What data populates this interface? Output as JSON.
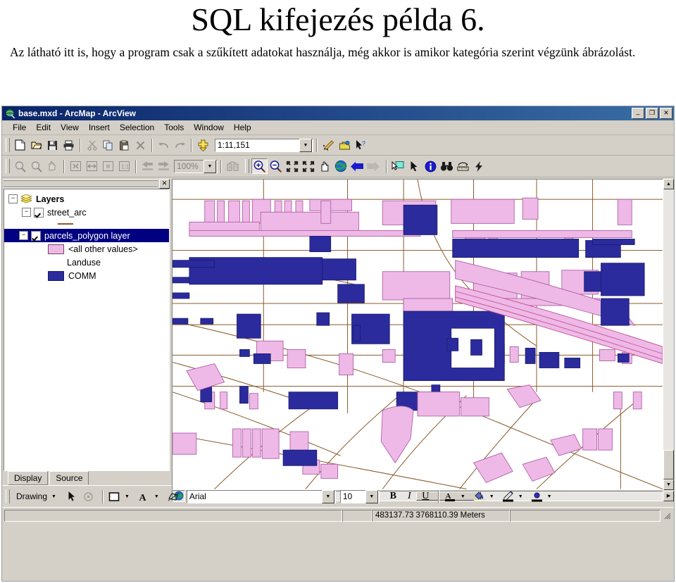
{
  "slide": {
    "title": "SQL kifejezés példa 6.",
    "body": "Az látható itt is, hogy a program csak a szűkített adatokat használja, még akkor is amikor kategória szerint végzünk ábrázolást."
  },
  "window": {
    "title": "base.mxd - ArcMap - ArcView",
    "app_icon": "arcmap-globe-icon",
    "controls": [
      {
        "name": "minimize-button",
        "glyph": "_"
      },
      {
        "name": "maximize-button",
        "glyph": "❐"
      },
      {
        "name": "close-button",
        "glyph": "✕"
      }
    ]
  },
  "menubar": {
    "items": [
      "File",
      "Edit",
      "View",
      "Insert",
      "Selection",
      "Tools",
      "Window",
      "Help"
    ]
  },
  "standard_toolbar": {
    "buttons": [
      {
        "name": "new-document-button",
        "icon": "new-page-icon",
        "glyph": "🗋",
        "disabled": false
      },
      {
        "name": "open-document-button",
        "icon": "open-folder-icon",
        "glyph": "📂",
        "disabled": false
      },
      {
        "name": "save-document-button",
        "icon": "floppy-disk-icon",
        "glyph": "💾",
        "disabled": false
      },
      {
        "name": "print-button",
        "icon": "printer-icon",
        "glyph": "🖶",
        "disabled": false
      },
      {
        "name": "cut-button",
        "icon": "scissors-icon",
        "glyph": "✂",
        "disabled": true
      },
      {
        "name": "copy-button",
        "icon": "copy-icon",
        "glyph": "⧉",
        "disabled": false
      },
      {
        "name": "paste-button",
        "icon": "clipboard-icon",
        "glyph": "📋",
        "disabled": false
      },
      {
        "name": "delete-button",
        "icon": "x-delete-icon",
        "glyph": "✕",
        "disabled": true
      },
      {
        "name": "undo-button",
        "icon": "undo-arrow-icon",
        "glyph": "↶",
        "disabled": true
      },
      {
        "name": "redo-button",
        "icon": "redo-arrow-icon",
        "glyph": "↷",
        "disabled": true
      },
      {
        "name": "add-data-button",
        "icon": "add-data-plus-icon",
        "glyph": "✚",
        "disabled": false
      }
    ],
    "scale_combo": {
      "name": "map-scale-combo",
      "value": "1:11,151"
    },
    "right_buttons": [
      {
        "name": "editor-toolbar-button",
        "icon": "pencil-edit-icon",
        "glyph": "✎"
      },
      {
        "name": "arctoolbox-button",
        "icon": "toolbox-icon",
        "glyph": "🧰"
      },
      {
        "name": "context-help-button",
        "icon": "arrow-question-icon",
        "glyph": "↖?"
      }
    ]
  },
  "layout_toolbar": {
    "disabled": true,
    "buttons": [
      {
        "name": "layout-zoom-in-button",
        "icon": "magnifier-plus-icon",
        "glyph": "⌕"
      },
      {
        "name": "layout-zoom-out-button",
        "icon": "magnifier-minus-icon",
        "glyph": "⌕"
      },
      {
        "name": "layout-pan-button",
        "icon": "hand-pan-icon",
        "glyph": "✋"
      },
      {
        "name": "zoom-whole-page-button",
        "icon": "whole-page-icon",
        "glyph": "⛶"
      },
      {
        "name": "zoom-page-width-button",
        "icon": "page-width-icon",
        "glyph": "⤢"
      },
      {
        "name": "zoom-to-selected-button",
        "icon": "zoom-selection-icon",
        "glyph": "⊡"
      },
      {
        "name": "zoom-100-percent-button",
        "icon": "one-to-one-icon",
        "glyph": "1:1"
      },
      {
        "name": "go-back-extent-button",
        "icon": "left-arrow-icon",
        "glyph": "⬅"
      },
      {
        "name": "go-forward-extent-button",
        "icon": "right-arrow-icon",
        "glyph": "➡"
      }
    ],
    "zoom_combo": {
      "name": "layout-zoom-percent-combo",
      "value": "100%"
    },
    "toggle_draft_button": {
      "name": "toggle-draft-mode-button",
      "icon": "draft-mode-icon",
      "glyph": "▤"
    }
  },
  "tools_toolbar": {
    "buttons": [
      {
        "name": "zoom-in-tool",
        "icon": "magnifier-plus-icon",
        "glyph": "+",
        "active": true
      },
      {
        "name": "zoom-out-tool",
        "icon": "magnifier-minus-icon",
        "glyph": "−",
        "active": false
      },
      {
        "name": "fixed-zoom-in-tool",
        "icon": "arrows-in-icon",
        "glyph": "⇲⇱",
        "active": false
      },
      {
        "name": "fixed-zoom-out-tool",
        "icon": "arrows-out-icon",
        "glyph": "⇱⇲",
        "active": false
      },
      {
        "name": "pan-tool",
        "icon": "hand-pan-icon",
        "glyph": "✋",
        "active": false
      },
      {
        "name": "full-extent-tool",
        "icon": "globe-icon",
        "glyph": "🌎",
        "active": false
      },
      {
        "name": "previous-extent-tool",
        "icon": "left-arrow-icon",
        "glyph": "⬅",
        "active": false
      },
      {
        "name": "next-extent-tool",
        "icon": "right-arrow-icon",
        "glyph": "➡",
        "active": false,
        "disabled": true
      },
      {
        "name": "select-features-tool",
        "icon": "select-features-icon",
        "glyph": "▧",
        "active": false
      },
      {
        "name": "select-elements-tool",
        "icon": "black-arrow-icon",
        "glyph": "➤",
        "active": false
      },
      {
        "name": "identify-tool",
        "icon": "info-circle-icon",
        "glyph": "i",
        "active": false
      },
      {
        "name": "find-tool",
        "icon": "binoculars-icon",
        "glyph": "🔭",
        "active": false
      },
      {
        "name": "measure-tool",
        "icon": "ruler-measure-icon",
        "glyph": "📏",
        "active": false
      },
      {
        "name": "hyperlink-tool",
        "icon": "lightning-bolt-icon",
        "glyph": "⚡",
        "active": false
      }
    ]
  },
  "toc": {
    "close_button": {
      "name": "toc-close-button",
      "glyph": "✕"
    },
    "nodes": [
      {
        "name": "toc-group-layers",
        "label": "Layers",
        "kind": "group",
        "expanded": true,
        "indent": 0,
        "icon": "layers-stack-icon"
      },
      {
        "name": "toc-layer-street-arc",
        "label": "street_arc",
        "kind": "layer",
        "expanded": true,
        "checked": true,
        "indent": 1,
        "selected": false
      },
      {
        "name": "toc-symbol-street-line",
        "label": "",
        "kind": "line-symbol",
        "indent": 3,
        "color": "#8a5a2b"
      },
      {
        "name": "toc-layer-parcels-polygon",
        "label": "parcels_polygon layer",
        "kind": "layer",
        "expanded": true,
        "checked": true,
        "indent": 1,
        "selected": true
      },
      {
        "name": "toc-symbol-all-other-values",
        "label": "<all other values>",
        "kind": "fill-symbol",
        "indent": 2,
        "color": "#eeb9e6"
      },
      {
        "name": "toc-heading-landuse",
        "label": "Landuse",
        "kind": "field-heading",
        "indent": 2
      },
      {
        "name": "toc-symbol-comm",
        "label": "COMM",
        "kind": "fill-symbol",
        "indent": 2,
        "color": "#2b2b9e"
      }
    ],
    "tabs": [
      {
        "name": "toc-tab-display",
        "label": "Display",
        "active": true
      },
      {
        "name": "toc-tab-source",
        "label": "Source",
        "active": false
      }
    ]
  },
  "view_controls": [
    {
      "name": "data-view-button",
      "icon": "globe-icon",
      "glyph": "🌎",
      "active": true
    },
    {
      "name": "layout-view-button",
      "icon": "page-icon",
      "glyph": "🗋",
      "active": false
    },
    {
      "name": "refresh-view-button",
      "icon": "refresh-arrows-icon",
      "glyph": "⟳",
      "active": false
    },
    {
      "name": "pause-drawing-button",
      "icon": "pause-triangle-icon",
      "glyph": "◀",
      "active": false
    }
  ],
  "drawing_toolbar": {
    "menu_label": "Drawing",
    "buttons": [
      {
        "name": "select-elements-button",
        "icon": "black-arrow-icon",
        "glyph": "➤"
      },
      {
        "name": "rotate-element-button",
        "icon": "rotate-icon",
        "glyph": "⟳",
        "disabled": true
      },
      {
        "name": "new-rectangle-button",
        "icon": "rectangle-icon",
        "glyph": "▭"
      },
      {
        "name": "new-text-button",
        "icon": "text-a-icon",
        "glyph": "A"
      },
      {
        "name": "edit-vertices-button",
        "icon": "edit-vertices-icon",
        "glyph": "⬡"
      }
    ],
    "font_combo": {
      "name": "font-family-combo",
      "value": "Arial"
    },
    "size_combo": {
      "name": "font-size-combo",
      "value": "10"
    },
    "style_buttons": [
      {
        "name": "bold-button",
        "icon": "bold-icon",
        "glyph": "B"
      },
      {
        "name": "italic-button",
        "icon": "italic-icon",
        "glyph": "I"
      },
      {
        "name": "underline-button",
        "icon": "underline-icon",
        "glyph": "U"
      }
    ],
    "color_buttons": [
      {
        "name": "font-color-button",
        "icon": "font-color-a-icon",
        "glyph": "A",
        "bar": "#000000"
      },
      {
        "name": "fill-color-button",
        "icon": "paint-bucket-icon",
        "glyph": "🪣",
        "bar": "#ffffcc"
      },
      {
        "name": "line-color-button",
        "icon": "pen-line-icon",
        "glyph": "✒",
        "bar": "#000000"
      },
      {
        "name": "marker-color-button",
        "icon": "marker-dot-icon",
        "glyph": "●",
        "bar": "#000000"
      }
    ]
  },
  "statusbar": {
    "coordinates": "483137.73  3768110.39 Meters",
    "left_pane": "",
    "right_pane": ""
  },
  "colors": {
    "parcel_other": "#eeb9e6",
    "parcel_other_outline": "#b060a8",
    "parcel_comm": "#2b2b9e",
    "street_line": "#8a5a2b",
    "map_background": "#ffffff",
    "selection_highlight": "#000080",
    "window_face": "#d4d0c8",
    "titlebar_start": "#0a246a"
  }
}
